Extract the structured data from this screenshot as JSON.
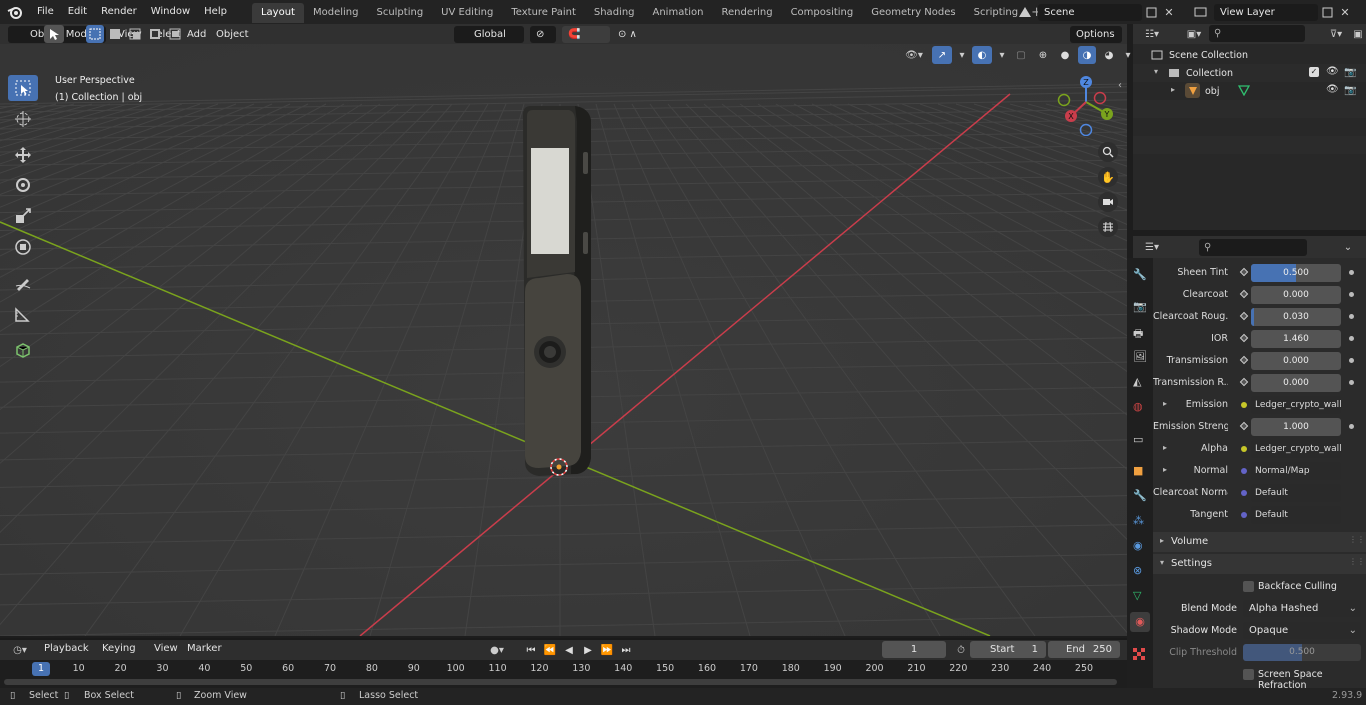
{
  "menus": [
    "File",
    "Edit",
    "Render",
    "Window",
    "Help"
  ],
  "workspace_tabs": [
    "Layout",
    "Modeling",
    "Sculpting",
    "UV Editing",
    "Texture Paint",
    "Shading",
    "Animation",
    "Rendering",
    "Compositing",
    "Geometry Nodes",
    "Scripting"
  ],
  "active_tab": "Layout",
  "scene_name": "Scene",
  "view_layer_name": "View Layer",
  "viewport_header": {
    "mode": "Object Mode",
    "menus": [
      "View",
      "Select",
      "Add",
      "Object"
    ],
    "transform_orientation": "Global",
    "options_label": "Options"
  },
  "viewport_overlay": {
    "perspective": "User Perspective",
    "collection_info": "(1) Collection | obj"
  },
  "gizmo_axes": {
    "x": "X",
    "y": "Y",
    "z": "Z"
  },
  "outliner": {
    "scene_collection": "Scene Collection",
    "collection": "Collection",
    "object": "obj"
  },
  "properties": {
    "rows": [
      {
        "label": "Sheen Tint",
        "value": "0.500",
        "fill": 0.5
      },
      {
        "label": "Clearcoat",
        "value": "0.000",
        "fill": 0
      },
      {
        "label": "Clearcoat Roug...",
        "value": "0.030",
        "fill": 0.03
      },
      {
        "label": "IOR",
        "value": "1.460",
        "fill": 0
      },
      {
        "label": "Transmission",
        "value": "0.000",
        "fill": 0
      },
      {
        "label": "Transmission R...",
        "value": "0.000",
        "fill": 0
      },
      {
        "label": "Emission",
        "value": "Ledger_crypto_wall...",
        "link": true,
        "color": "#c7c729"
      },
      {
        "label": "Emission Strengt",
        "value": "1.000",
        "fill": 0
      },
      {
        "label": "Alpha",
        "value": "Ledger_crypto_wall...",
        "link": true,
        "color": "#c7c729"
      },
      {
        "label": "Normal",
        "value": "Normal/Map",
        "link": true,
        "color": "#6363c7"
      },
      {
        "label": "Clearcoat Normal",
        "value": "Default",
        "link": true,
        "color": "#6363c7"
      },
      {
        "label": "Tangent",
        "value": "Default",
        "link": true,
        "color": "#6363c7"
      }
    ],
    "volume_panel": "Volume",
    "settings_panel": "Settings",
    "backface_culling": "Backface Culling",
    "blend_mode_label": "Blend Mode",
    "blend_mode_value": "Alpha Hashed",
    "shadow_mode_label": "Shadow Mode",
    "shadow_mode_value": "Opaque",
    "clip_threshold_label": "Clip Threshold",
    "clip_threshold_value": "0.500",
    "screen_space_refraction": "Screen Space Refraction"
  },
  "timeline": {
    "menus": [
      "Playback",
      "Keying",
      "View",
      "Marker"
    ],
    "current_frame": "1",
    "start_label": "Start",
    "start_value": "1",
    "end_label": "End",
    "end_value": "250",
    "frame_marks": [
      "1",
      "10",
      "20",
      "30",
      "40",
      "50",
      "60",
      "70",
      "80",
      "90",
      "100",
      "110",
      "120",
      "130",
      "140",
      "150",
      "160",
      "170",
      "180",
      "190",
      "200",
      "210",
      "220",
      "230",
      "240",
      "250"
    ]
  },
  "statusbar": {
    "select": "Select",
    "box_select": "Box Select",
    "zoom_view": "Zoom View",
    "lasso_select": "Lasso Select",
    "version": "2.93.9"
  },
  "colors": {
    "accent": "#4772b3",
    "x_axis": "#c93d4b",
    "y_axis": "#7aa31d",
    "z_axis": "#4f87e0"
  }
}
